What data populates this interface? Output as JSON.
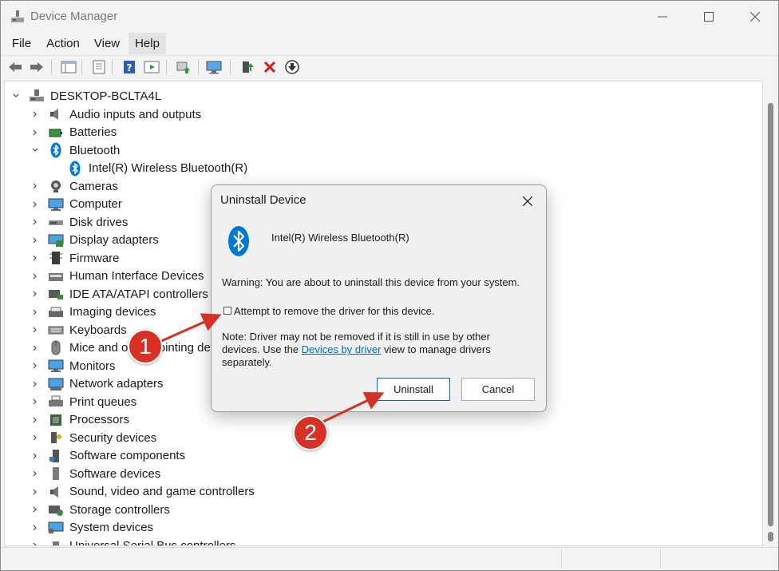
{
  "window": {
    "title": "Device Manager"
  },
  "menu": [
    "File",
    "Action",
    "View",
    "Help"
  ],
  "tree": {
    "root": "DESKTOP-BCLTA4L",
    "categories": [
      {
        "label": "Audio inputs and outputs",
        "icon": "speaker-icon"
      },
      {
        "label": "Batteries",
        "icon": "battery-icon"
      },
      {
        "label": "Bluetooth",
        "icon": "bluetooth-icon",
        "expanded": true,
        "children": [
          "Intel(R) Wireless Bluetooth(R)"
        ]
      },
      {
        "label": "Cameras",
        "icon": "camera-icon"
      },
      {
        "label": "Computer",
        "icon": "monitor-icon"
      },
      {
        "label": "Disk drives",
        "icon": "disk-drive-icon"
      },
      {
        "label": "Display adapters",
        "icon": "display-adapter-icon"
      },
      {
        "label": "Firmware",
        "icon": "chip-icon"
      },
      {
        "label": "Human Interface Devices",
        "icon": "hid-icon"
      },
      {
        "label": "IDE ATA/ATAPI controllers",
        "icon": "ide-icon"
      },
      {
        "label": "Imaging devices",
        "icon": "imaging-icon"
      },
      {
        "label": "Keyboards",
        "icon": "keyboard-icon"
      },
      {
        "label": "Mice and other pointing devices",
        "icon": "mouse-icon"
      },
      {
        "label": "Monitors",
        "icon": "monitor-icon"
      },
      {
        "label": "Network adapters",
        "icon": "network-icon"
      },
      {
        "label": "Print queues",
        "icon": "printer-icon"
      },
      {
        "label": "Processors",
        "icon": "processor-icon"
      },
      {
        "label": "Security devices",
        "icon": "security-icon"
      },
      {
        "label": "Software components",
        "icon": "software-component-icon"
      },
      {
        "label": "Software devices",
        "icon": "software-device-icon"
      },
      {
        "label": "Sound, video and game controllers",
        "icon": "speaker-icon"
      },
      {
        "label": "Storage controllers",
        "icon": "storage-icon"
      },
      {
        "label": "System devices",
        "icon": "system-icon"
      },
      {
        "label": "Universal Serial Bus controllers",
        "icon": "usb-icon"
      }
    ]
  },
  "dialog": {
    "title": "Uninstall Device",
    "device_name": "Intel(R) Wireless Bluetooth(R)",
    "warning": "Warning: You are about to uninstall this device from your system.",
    "checkbox_label": "Attempt to remove the driver for this device.",
    "checkbox_checked": false,
    "note_before": "Note: Driver may not be removed if it is still in use by other devices. Use the ",
    "note_link": "Devices by driver",
    "note_after": " view to manage drivers separately.",
    "uninstall_label": "Uninstall",
    "cancel_label": "Cancel"
  },
  "callouts": [
    "1",
    "2"
  ],
  "colors": {
    "callout": "#d93025",
    "link": "#0066cc",
    "bluetooth": "#0078d7"
  }
}
